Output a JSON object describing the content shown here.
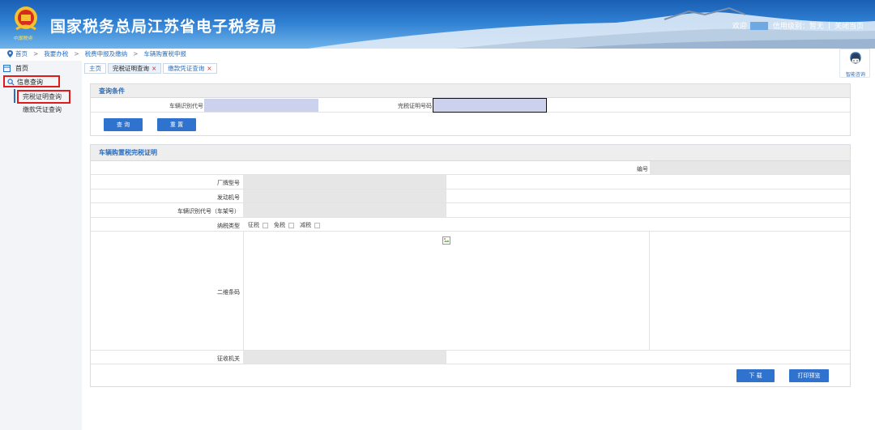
{
  "header": {
    "title": "国家税务总局江苏省电子税务局",
    "brand_sub": "中国税务",
    "welcome": "欢迎",
    "credit": "信用级别：暂无",
    "divider": "|",
    "close": "关闭当页"
  },
  "breadcrumb": {
    "items": [
      "首页",
      "我要办税",
      "税费申报及缴纳",
      "车辆购置税申报"
    ],
    "separator": ">"
  },
  "sidebar": {
    "home": "首页",
    "section": "信息查询",
    "items": [
      "完税证明查询",
      "缴款凭证查询"
    ]
  },
  "tabs": [
    {
      "label": "主页",
      "closable": false
    },
    {
      "label": "完税证明查询",
      "closable": true
    },
    {
      "label": "缴款凭证查询",
      "closable": true
    }
  ],
  "tab_close_glyph": "×",
  "consult": {
    "label": "智能咨询"
  },
  "query": {
    "title": "查询条件",
    "vin_label": "车辆识别代号",
    "vin_value": "",
    "cert_label": "完税证明号码",
    "cert_value": "",
    "search_btn": "查 询",
    "reset_btn": "重 置"
  },
  "certificate": {
    "title": "车辆购置税完税证明",
    "number_label": "编号",
    "brand_label": "厂牌型号",
    "engine_label": "发动机号",
    "vin_label": "车辆识别代号（车架号）",
    "tax_type_label": "纳税类型",
    "tax_options": [
      "征税",
      "免税",
      "减税"
    ],
    "qr_label": "二维条码",
    "authority_label": "征收机关",
    "download_btn": "下 载",
    "print_btn": "打印预览"
  },
  "colors": {
    "header_blue": "#2e7fd2",
    "link_blue": "#2a6fc0",
    "button_blue": "#2f73cf",
    "highlight_red": "#e01b1b",
    "input_fill": "#ccd2ee"
  }
}
